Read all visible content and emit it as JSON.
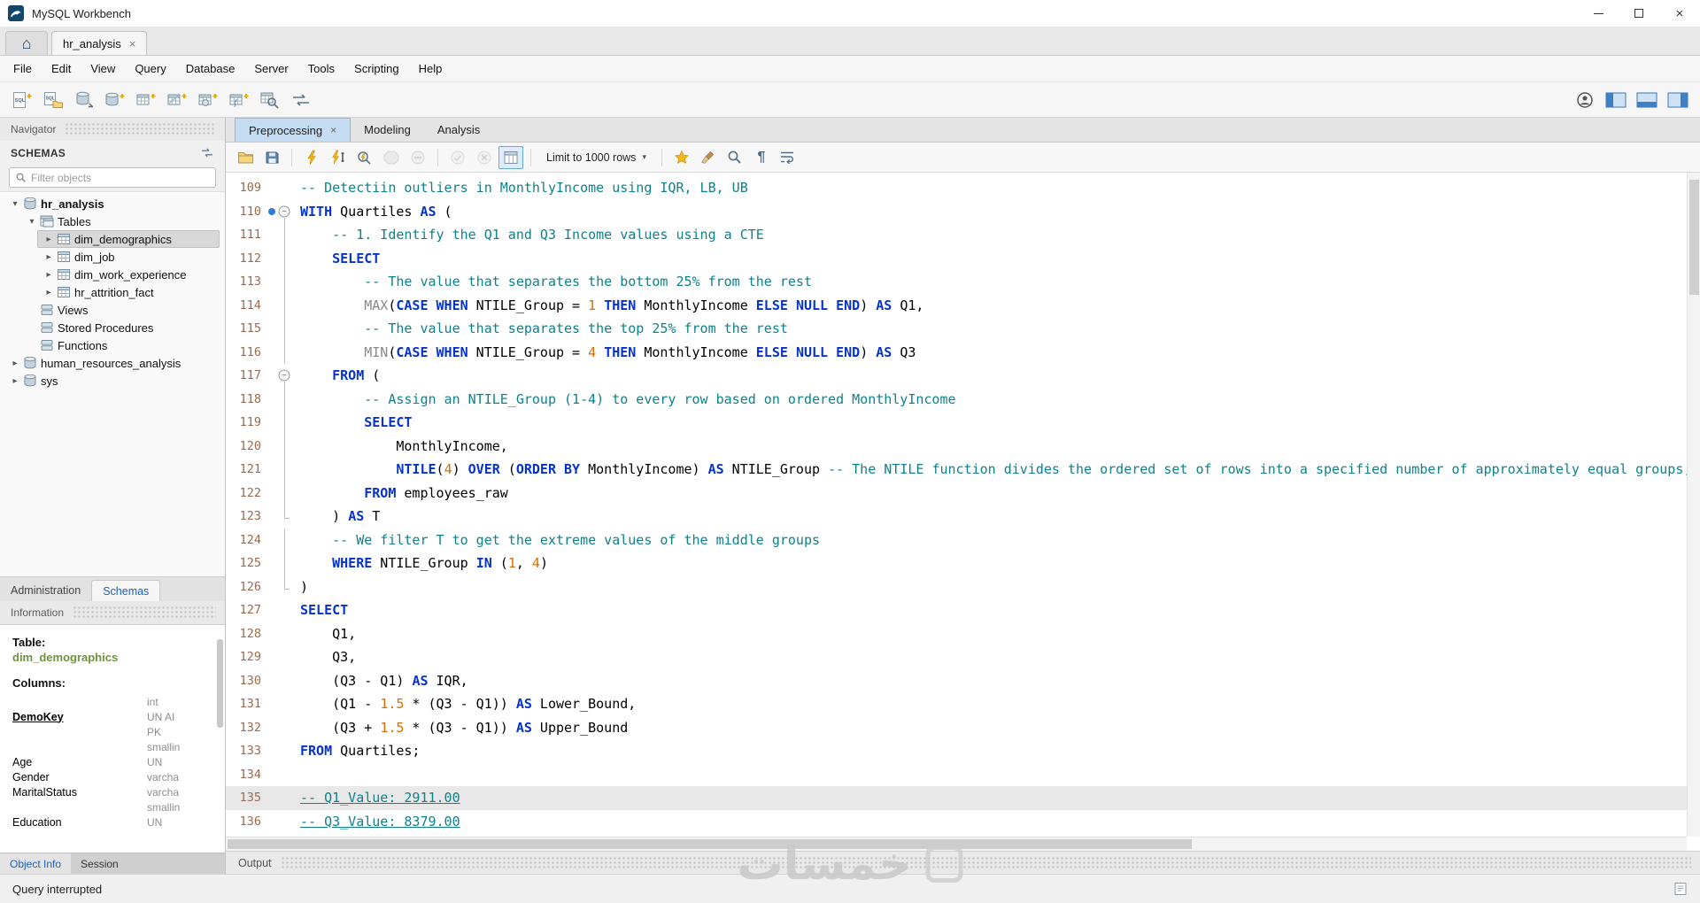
{
  "window": {
    "title": "MySQL Workbench"
  },
  "connection_tabs": {
    "active_tab": "hr_analysis",
    "close_glyph": "×"
  },
  "menu": {
    "items": [
      "File",
      "Edit",
      "View",
      "Query",
      "Database",
      "Server",
      "Tools",
      "Scripting",
      "Help"
    ]
  },
  "main_toolbar": {
    "left_icons": [
      "new-query-tab",
      "open-sql-script",
      "connect-db",
      "create-schema",
      "create-table",
      "create-view",
      "create-procedure",
      "create-function",
      "search-data",
      "migration"
    ],
    "right_icons": [
      "account",
      "panel-left",
      "panel-bottom",
      "panel-right"
    ]
  },
  "sidebar": {
    "navigator_title": "Navigator",
    "schemas_title": "SCHEMAS",
    "filter_placeholder": "Filter objects",
    "tree": [
      {
        "label": "hr_analysis",
        "level": 0,
        "arrow": "expanded",
        "icon": "schema",
        "bold": true
      },
      {
        "label": "Tables",
        "level": 1,
        "arrow": "expanded",
        "icon": "tables"
      },
      {
        "label": "dim_demographics",
        "level": 2,
        "arrow": "collapsed",
        "icon": "table",
        "selected": true
      },
      {
        "label": "dim_job",
        "level": 2,
        "arrow": "collapsed",
        "icon": "table"
      },
      {
        "label": "dim_work_experience",
        "level": 2,
        "arrow": "collapsed",
        "icon": "table"
      },
      {
        "label": "hr_attrition_fact",
        "level": 2,
        "arrow": "collapsed",
        "icon": "table"
      },
      {
        "label": "Views",
        "level": 1,
        "arrow": "none",
        "icon": "group"
      },
      {
        "label": "Stored Procedures",
        "level": 1,
        "arrow": "none",
        "icon": "group"
      },
      {
        "label": "Functions",
        "level": 1,
        "arrow": "none",
        "icon": "group"
      },
      {
        "label": "human_resources_analysis",
        "level": 0,
        "arrow": "collapsed",
        "icon": "schema"
      },
      {
        "label": "sys",
        "level": 0,
        "arrow": "collapsed",
        "icon": "schema"
      }
    ],
    "panel_tabs": {
      "items": [
        "Administration",
        "Schemas"
      ],
      "active": "Schemas"
    },
    "information_title": "Information",
    "info": {
      "table_label": "Table:",
      "table_name": "dim_demographics",
      "columns_label": "Columns:",
      "rows": [
        {
          "name": "",
          "type": "int"
        },
        {
          "name": "DemoKey",
          "type": "UN AI",
          "primary": true
        },
        {
          "name": "",
          "type": "PK"
        },
        {
          "name": "",
          "type": "smallin"
        },
        {
          "name": "Age",
          "type": "UN"
        },
        {
          "name": "Gender",
          "type": "varcha"
        },
        {
          "name": "MaritalStatus",
          "type": "varcha"
        },
        {
          "name": "",
          "type": "smallin"
        },
        {
          "name": "Education",
          "type": "UN"
        }
      ]
    },
    "footer_tabs": {
      "items": [
        "Object Info",
        "Session"
      ],
      "active": "Object Info"
    }
  },
  "editor": {
    "tabs": [
      {
        "label": "Preprocessing",
        "active": true,
        "closable": true
      },
      {
        "label": "Modeling",
        "active": false
      },
      {
        "label": "Analysis",
        "active": false
      }
    ],
    "toolbar": {
      "limit_label": "Limit to 1000 rows",
      "icons": [
        {
          "name": "open-script",
          "icon": "folder"
        },
        {
          "name": "save-script",
          "icon": "save"
        },
        "sep",
        {
          "name": "execute-all",
          "icon": "bolt"
        },
        {
          "name": "execute-current",
          "icon": "bolt-cursor"
        },
        {
          "name": "explain",
          "icon": "bolt-mag"
        },
        {
          "name": "stop",
          "icon": "stop",
          "disabled": true
        },
        {
          "name": "toggle-stop-on-error",
          "icon": "stop-bar",
          "disabled": true
        },
        "sep",
        {
          "name": "commit",
          "icon": "check-circle",
          "disabled": true
        },
        {
          "name": "rollback",
          "icon": "x-circle",
          "disabled": true
        },
        {
          "name": "autocommit",
          "icon": "autocommit",
          "active": true
        },
        "sep",
        {
          "name": "limit-rows",
          "type": "dropdown"
        },
        "sep",
        {
          "name": "save-snippet",
          "icon": "star"
        },
        {
          "name": "beautify",
          "icon": "broom"
        },
        {
          "name": "find",
          "icon": "search-lg"
        },
        {
          "name": "invisible-chars",
          "icon": "pilcrow"
        },
        {
          "name": "wrap-text",
          "icon": "wrap"
        }
      ]
    },
    "code": {
      "lines": [
        {
          "n": 109,
          "tokens": [
            [
              "com",
              "-- Detectiin outliers in MonthlyIncome using IQR, LB, UB"
            ]
          ]
        },
        {
          "n": 110,
          "marker": true,
          "fold": "start",
          "tokens": [
            [
              "kw",
              "WITH"
            ],
            [
              "t",
              " Quartiles "
            ],
            [
              "kw",
              "AS"
            ],
            [
              "t",
              " ("
            ]
          ]
        },
        {
          "n": 111,
          "fold": "line",
          "tokens": [
            [
              "t",
              "    "
            ],
            [
              "com",
              "-- 1. Identify the Q1 and Q3 Income values using a CTE"
            ]
          ]
        },
        {
          "n": 112,
          "fold": "line",
          "tokens": [
            [
              "t",
              "    "
            ],
            [
              "kw",
              "SELECT"
            ]
          ]
        },
        {
          "n": 113,
          "fold": "line",
          "tokens": [
            [
              "t",
              "        "
            ],
            [
              "com",
              "-- The value that separates the bottom 25% from the rest"
            ]
          ]
        },
        {
          "n": 114,
          "fold": "line",
          "tokens": [
            [
              "t",
              "        "
            ],
            [
              "fn",
              "MAX"
            ],
            [
              "t",
              "("
            ],
            [
              "kw",
              "CASE"
            ],
            [
              "t",
              " "
            ],
            [
              "kw",
              "WHEN"
            ],
            [
              "t",
              " NTILE_Group = "
            ],
            [
              "num",
              "1"
            ],
            [
              "t",
              " "
            ],
            [
              "kw",
              "THEN"
            ],
            [
              "t",
              " MonthlyIncome "
            ],
            [
              "kw",
              "ELSE"
            ],
            [
              "t",
              " "
            ],
            [
              "kw",
              "NULL"
            ],
            [
              "t",
              " "
            ],
            [
              "kw",
              "END"
            ],
            [
              "t",
              ") "
            ],
            [
              "kw",
              "AS"
            ],
            [
              "t",
              " Q1,"
            ]
          ]
        },
        {
          "n": 115,
          "fold": "line",
          "tokens": [
            [
              "t",
              "        "
            ],
            [
              "com",
              "-- The value that separates the top 25% from the rest"
            ]
          ]
        },
        {
          "n": 116,
          "fold": "line",
          "tokens": [
            [
              "t",
              "        "
            ],
            [
              "fn",
              "MIN"
            ],
            [
              "t",
              "("
            ],
            [
              "kw",
              "CASE"
            ],
            [
              "t",
              " "
            ],
            [
              "kw",
              "WHEN"
            ],
            [
              "t",
              " NTILE_Group = "
            ],
            [
              "num",
              "4"
            ],
            [
              "t",
              " "
            ],
            [
              "kw",
              "THEN"
            ],
            [
              "t",
              " MonthlyIncome "
            ],
            [
              "kw",
              "ELSE"
            ],
            [
              "t",
              " "
            ],
            [
              "kw",
              "NULL"
            ],
            [
              "t",
              " "
            ],
            [
              "kw",
              "END"
            ],
            [
              "t",
              ") "
            ],
            [
              "kw",
              "AS"
            ],
            [
              "t",
              " Q3"
            ]
          ]
        },
        {
          "n": 117,
          "fold": "start",
          "tokens": [
            [
              "t",
              "    "
            ],
            [
              "kw",
              "FROM"
            ],
            [
              "t",
              " ("
            ]
          ]
        },
        {
          "n": 118,
          "fold": "line",
          "tokens": [
            [
              "t",
              "        "
            ],
            [
              "com",
              "-- Assign an NTILE_Group (1-4) to every row based on ordered MonthlyIncome"
            ]
          ]
        },
        {
          "n": 119,
          "fold": "line",
          "tokens": [
            [
              "t",
              "        "
            ],
            [
              "kw",
              "SELECT"
            ]
          ]
        },
        {
          "n": 120,
          "fold": "line",
          "tokens": [
            [
              "t",
              "            MonthlyIncome,"
            ]
          ]
        },
        {
          "n": 121,
          "fold": "line",
          "tokens": [
            [
              "t",
              "            "
            ],
            [
              "kw",
              "NTILE"
            ],
            [
              "t",
              "("
            ],
            [
              "num",
              "4"
            ],
            [
              "t",
              ") "
            ],
            [
              "kw",
              "OVER"
            ],
            [
              "t",
              " ("
            ],
            [
              "kw",
              "ORDER"
            ],
            [
              "t",
              " "
            ],
            [
              "kw",
              "BY"
            ],
            [
              "t",
              " MonthlyIncome) "
            ],
            [
              "kw",
              "AS"
            ],
            [
              "t",
              " NTILE_Group "
            ],
            [
              "com",
              "-- The NTILE function divides the ordered set of rows into a specified number of approximately equal groups, o"
            ]
          ]
        },
        {
          "n": 122,
          "fold": "line",
          "tokens": [
            [
              "t",
              "        "
            ],
            [
              "kw",
              "FROM"
            ],
            [
              "t",
              " employees_raw"
            ]
          ]
        },
        {
          "n": 123,
          "fold": "end",
          "tokens": [
            [
              "t",
              "    ) "
            ],
            [
              "kw",
              "AS"
            ],
            [
              "t",
              " T"
            ]
          ]
        },
        {
          "n": 124,
          "fold": "line",
          "tokens": [
            [
              "t",
              "    "
            ],
            [
              "com",
              "-- We filter T to get the extreme values of the middle groups"
            ]
          ]
        },
        {
          "n": 125,
          "fold": "line",
          "tokens": [
            [
              "t",
              "    "
            ],
            [
              "kw",
              "WHERE"
            ],
            [
              "t",
              " NTILE_Group "
            ],
            [
              "kw",
              "IN"
            ],
            [
              "t",
              " ("
            ],
            [
              "num",
              "1"
            ],
            [
              "t",
              ", "
            ],
            [
              "num",
              "4"
            ],
            [
              "t",
              ")"
            ]
          ]
        },
        {
          "n": 126,
          "fold": "end",
          "tokens": [
            [
              "t",
              ")"
            ]
          ]
        },
        {
          "n": 127,
          "tokens": [
            [
              "kw",
              "SELECT"
            ]
          ]
        },
        {
          "n": 128,
          "tokens": [
            [
              "t",
              "    Q1,"
            ]
          ]
        },
        {
          "n": 129,
          "tokens": [
            [
              "t",
              "    Q3,"
            ]
          ]
        },
        {
          "n": 130,
          "tokens": [
            [
              "t",
              "    (Q3 - Q1) "
            ],
            [
              "kw",
              "AS"
            ],
            [
              "t",
              " IQR,"
            ]
          ]
        },
        {
          "n": 131,
          "tokens": [
            [
              "t",
              "    (Q1 - "
            ],
            [
              "num",
              "1.5"
            ],
            [
              "t",
              " * (Q3 - Q1)) "
            ],
            [
              "kw",
              "AS"
            ],
            [
              "t",
              " Lower_Bound,"
            ]
          ]
        },
        {
          "n": 132,
          "tokens": [
            [
              "t",
              "    (Q3 + "
            ],
            [
              "num",
              "1.5"
            ],
            [
              "t",
              " * (Q3 - Q1)) "
            ],
            [
              "kw",
              "AS"
            ],
            [
              "t",
              " Upper_Bound"
            ]
          ]
        },
        {
          "n": 133,
          "tokens": [
            [
              "kw",
              "FROM"
            ],
            [
              "t",
              " Quartiles;"
            ]
          ]
        },
        {
          "n": 134,
          "tokens": []
        },
        {
          "n": 135,
          "highlight": true,
          "tokens": [
            [
              "comu",
              "-- Q1_Value: 2911.00"
            ]
          ]
        },
        {
          "n": 136,
          "tokens": [
            [
              "comu",
              "-- Q3_Value: 8379.00"
            ]
          ]
        }
      ]
    }
  },
  "output": {
    "title": "Output"
  },
  "status": {
    "text": "Query interrupted"
  },
  "watermark": {
    "text": "خمسات"
  },
  "colors": {
    "keyword": "#0533cc",
    "comment": "#0d828c",
    "number": "#d66e00",
    "function": "#888888",
    "line_number": "#9b6a50",
    "active_tab_bg": "#c6dcf2",
    "selection_bg": "#d8d8d8"
  }
}
